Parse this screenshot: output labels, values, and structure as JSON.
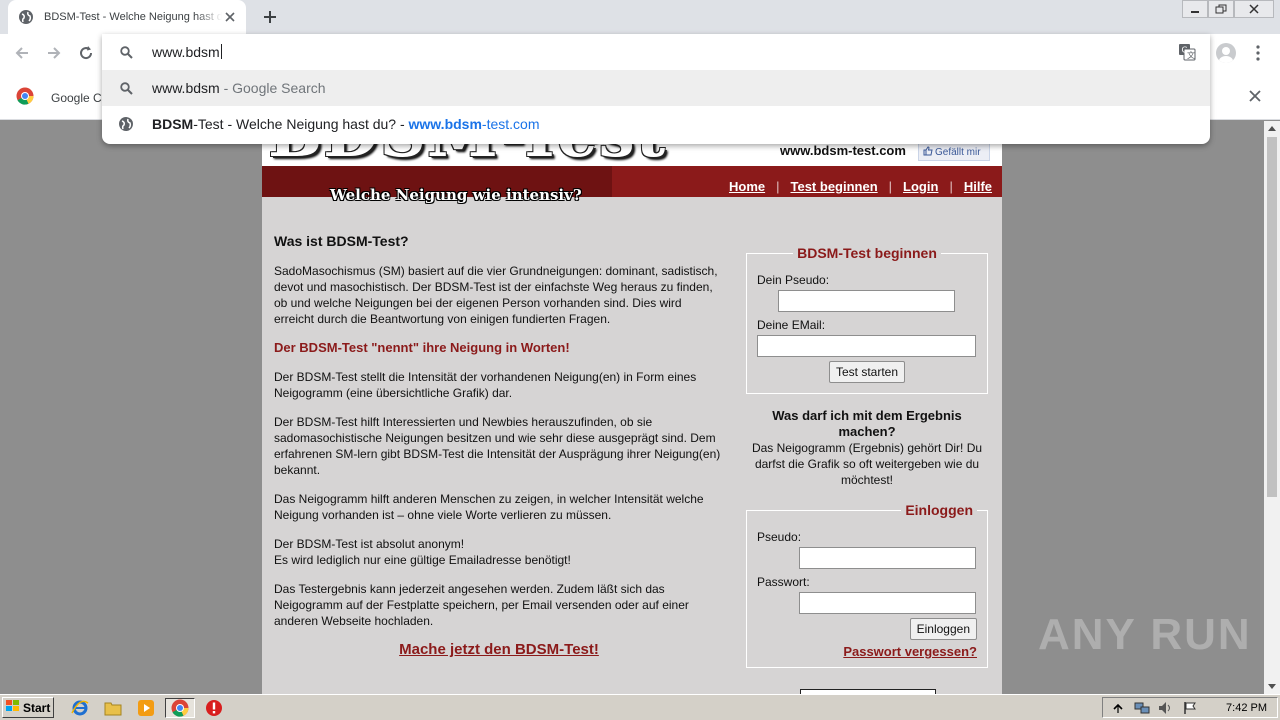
{
  "browser": {
    "tab_title": "BDSM-Test - Welche Neigung hast du?",
    "omnibox_value": "www.bdsm",
    "suggestions": [
      {
        "prefix": "www.bdsm",
        "suffix": " - Google Search"
      },
      {
        "bold": "BDSM",
        "title_rest": "-Test - Welche Neigung hast du? - ",
        "url_bold": "www.bdsm",
        "url_rest": "-test.com"
      }
    ],
    "bookmark_label": "Google Chrome"
  },
  "site": {
    "logo": "BDSM-Test",
    "tagline": "Welche Neigung wie intensiv?",
    "domain": "www.bdsm-test.com",
    "fb_like": "Gefällt mir",
    "nav": [
      "Home",
      "Test beginnen",
      "Login",
      "Hilfe"
    ],
    "heading": "Was ist BDSM-Test?",
    "paragraphs": [
      "SadoMasochismus (SM) basiert auf die vier Grundneigungen: dominant, sadistisch, devot und masochistisch. Der BDSM-Test ist der einfachste Weg heraus zu finden, ob und welche Neigungen bei der eigenen Person vorhanden sind. Dies wird erreicht durch die Beantwortung von einigen fundierten Fragen.",
      "Der BDSM-Test \"nennt\" ihre Neigung in Worten!",
      "Der BDSM-Test stellt die Intensität der vorhandenen Neigung(en) in Form eines Neigogramm (eine übersichtliche Grafik) dar.",
      "Der BDSM-Test hilft Interessierten und Newbies herauszufinden, ob sie sadomasochistische Neigungen besitzen und wie sehr diese ausgeprägt sind. Dem erfahrenen SM-lern gibt BDSM-Test die Intensität der Ausprägung ihrer Neigung(en) bekannt.",
      "Das Neigogramm hilft anderen Menschen zu zeigen, in welcher Intensität welche Neigung vorhanden ist – ohne viele Worte verlieren zu müssen.",
      "Der BDSM-Test ist absolut anonym!",
      "Es wird lediglich nur eine gültige Emailadresse benötigt!",
      "Das Testergebnis kann jederzeit angesehen werden. Zudem läßt sich das Neigogramm auf der Festplatte speichern, per Email versenden oder auf einer anderen Webseite hochladen."
    ],
    "cta": "Mache jetzt den BDSM-Test!",
    "start_box": {
      "legend": "BDSM-Test beginnen",
      "pseudo_label": "Dein Pseudo:",
      "email_label": "Deine EMail:",
      "button": "Test starten"
    },
    "result_info": {
      "heading": "Was darf ich mit dem Ergebnis machen?",
      "text": "Das Neigogramm (Ergebnis) gehört Dir! Du darfst die Grafik so oft weitergeben wie du möchtest!"
    },
    "login_box": {
      "legend": "Einloggen",
      "pseudo_label": "Pseudo:",
      "password_label": "Passwort:",
      "button": "Einloggen",
      "forgot": "Passwort vergessen?"
    }
  },
  "watermark": "ANY RUN",
  "taskbar": {
    "start": "Start",
    "clock": "7:42 PM"
  }
}
